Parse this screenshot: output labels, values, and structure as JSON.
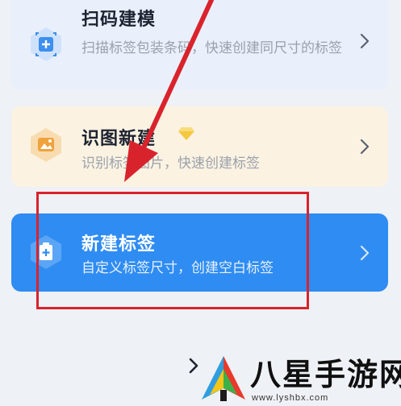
{
  "colors": {
    "background": "#eef1f6",
    "scan_card_bg": "#e9f0fb",
    "recognize_card_bg": "#fbf2e2",
    "new_card_bg": "#2f8cf2",
    "annotation_red": "#d9232c",
    "title_text": "#1d2330",
    "desc_text": "#9ba1ab"
  },
  "options": [
    {
      "id": "scan",
      "icon": "scan-barcode-icon",
      "title": "扫码建模",
      "description": "扫描标签包装条码，快速创建同尺寸的标签"
    },
    {
      "id": "recognize",
      "icon": "image-recognize-icon",
      "title": "识图新建",
      "badge_icon": "diamond-icon",
      "description": "识别标签图片，快速创建标签"
    },
    {
      "id": "new",
      "icon": "new-label-icon",
      "title": "新建标签",
      "description": "自定义标签尺寸，创建空白标签"
    }
  ],
  "annotation": {
    "arrow": "red-arrow",
    "highlight": "red-highlight-box"
  },
  "watermark": {
    "logo_icon": "site-logo-icon",
    "text": "八星手游网",
    "url": "www.lyshbx.com"
  }
}
